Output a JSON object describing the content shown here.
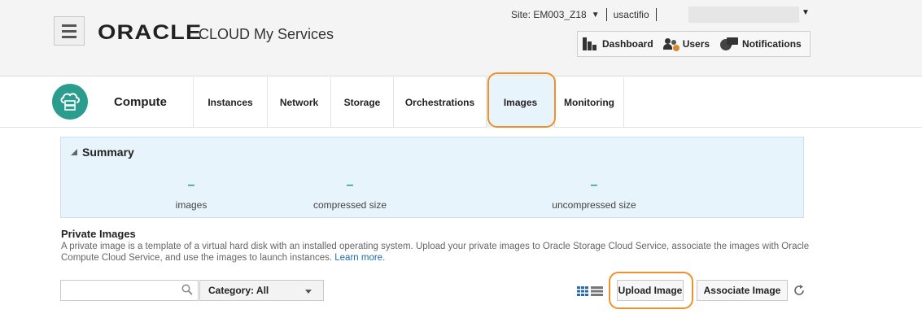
{
  "header": {
    "menu_icon": "hamburger-icon",
    "brand": "ORACLE",
    "product": "CLOUD My Services",
    "site_label": "Site: EM003_Z18",
    "user_label": "usactifio",
    "nav": {
      "dashboard": "Dashboard",
      "users": "Users",
      "notifications": "Notifications"
    }
  },
  "service": {
    "icon": "cloud-server-icon",
    "title": "Compute",
    "tabs": [
      "Instances",
      "Network",
      "Storage",
      "Orchestrations",
      "Images",
      "Monitoring"
    ],
    "active_tab": "Images"
  },
  "summary": {
    "heading": "Summary",
    "metrics": [
      {
        "value": "–",
        "label": "images"
      },
      {
        "value": "–",
        "label": "compressed size"
      },
      {
        "value": "–",
        "label": "uncompressed size"
      }
    ]
  },
  "private_images": {
    "title": "Private Images",
    "description": "A private image is a template of a virtual hard disk with an installed operating system. Upload your private images to Oracle Storage Cloud Service, associate the images with Oracle Compute Cloud Service, and use the images to launch instances.",
    "learn_more": "Learn more."
  },
  "toolbar": {
    "search_value": "",
    "category_label": "Category: All",
    "upload_label": "Upload Image",
    "associate_label": "Associate Image"
  },
  "colors": {
    "accent_teal": "#2a9d8f",
    "highlight_orange": "#f0902a",
    "summary_bg": "#e8f4fb",
    "grid_icon_blue": "#2b6cb0"
  }
}
